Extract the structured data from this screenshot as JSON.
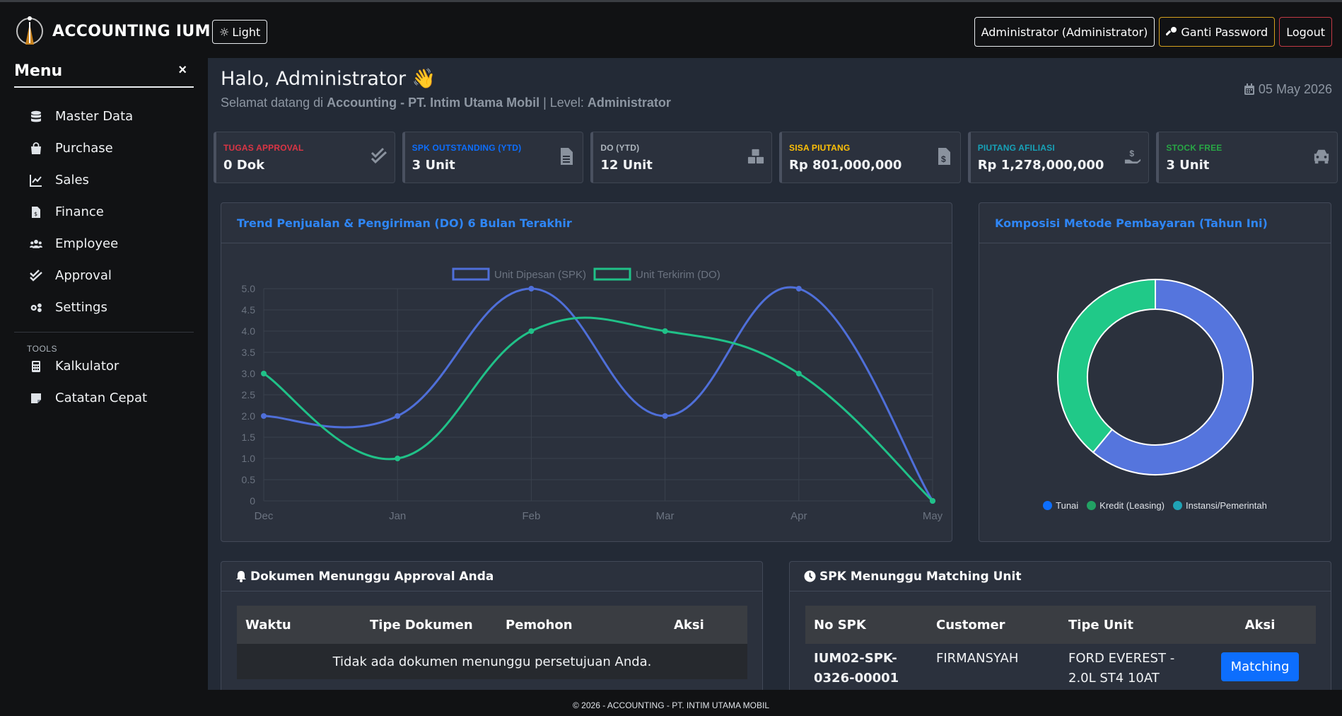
{
  "navbar": {
    "brand": "ACCOUNTING IUM",
    "theme_label": "Light",
    "user_label": "Administrator (Administrator)",
    "password_label": "Ganti Password",
    "logout_label": "Logout"
  },
  "sidebar": {
    "title": "Menu",
    "close": "×",
    "items": [
      {
        "label": "Master Data",
        "icon": "database-icon"
      },
      {
        "label": "Purchase",
        "icon": "shopping-bag-icon"
      },
      {
        "label": "Sales",
        "icon": "line-chart-icon"
      },
      {
        "label": "Finance",
        "icon": "invoice-icon"
      },
      {
        "label": "Employee",
        "icon": "users-icon"
      },
      {
        "label": "Approval",
        "icon": "double-check-icon"
      },
      {
        "label": "Settings",
        "icon": "gears-icon"
      }
    ],
    "tools_title": "TOOLS",
    "tools": [
      {
        "label": "Kalkulator",
        "icon": "calculator-icon"
      },
      {
        "label": "Catatan Cepat",
        "icon": "sticky-note-icon"
      }
    ]
  },
  "header": {
    "greeting": "Halo, Administrator 👋",
    "welcome_prefix": "Selamat datang di ",
    "app_name": "Accounting - PT. Intim Utama Mobil",
    "level_prefix": " | Level: ",
    "level": "Administrator",
    "date": "05 May 2026"
  },
  "cards": [
    {
      "label": "TUGAS APPROVAL",
      "value": "0 Dok",
      "color": "#dc3545",
      "icon": "double-check-icon"
    },
    {
      "label": "SPK OUTSTANDING (YTD)",
      "value": "3 Unit",
      "color": "#0d6efd",
      "icon": "file-icon"
    },
    {
      "label": "DO (YTD)",
      "value": "12 Unit",
      "color": "#adb5bd",
      "icon": "boxes-icon"
    },
    {
      "label": "SISA PIUTANG",
      "value": "Rp 801,000,000",
      "color": "#ffc107",
      "icon": "invoice-dollar-icon"
    },
    {
      "label": "PIUTANG AFILIASI",
      "value": "Rp 1,278,000,000",
      "color": "#17a2b8",
      "icon": "hand-dollar-icon"
    },
    {
      "label": "STOCK FREE",
      "value": "3 Unit",
      "color": "#28a745",
      "icon": "car-icon"
    }
  ],
  "line_panel": {
    "title": "Trend Penjualan & Pengiriman (DO) 6 Bulan Terakhir"
  },
  "donut_panel": {
    "title": "Komposisi Metode Pembayaran (Tahun Ini)"
  },
  "chart_data": [
    {
      "type": "line",
      "x": [
        "Dec",
        "Jan",
        "Feb",
        "Mar",
        "Apr",
        "May"
      ],
      "series": [
        {
          "name": "Unit Dipesan (SPK)",
          "values": [
            2,
            2,
            5,
            2,
            5,
            0
          ],
          "color": "#4f6fd9"
        },
        {
          "name": "Unit Terkirim (DO)",
          "values": [
            3,
            1,
            4,
            4,
            3,
            0
          ],
          "color": "#20c188"
        }
      ],
      "ylim": [
        0,
        5
      ],
      "yticks": [
        "0",
        "0.5",
        "1.0",
        "1.5",
        "2.0",
        "2.5",
        "3.0",
        "3.5",
        "4.0",
        "4.5",
        "5.0"
      ],
      "grid": true,
      "legend": "top"
    },
    {
      "type": "pie",
      "categories": [
        "Tunai",
        "Kredit (Leasing)",
        "Instansi/Pemerintah"
      ],
      "values": [
        61,
        39,
        0
      ],
      "colors": [
        "#5575dd",
        "#20c988",
        "#20a3b5"
      ],
      "legend_colors": [
        "#0d6efd",
        "#22a163",
        "#20a3b5"
      ],
      "legend": "bottom"
    }
  ],
  "approval_panel": {
    "title": "Dokumen Menunggu Approval Anda",
    "columns": [
      "Waktu",
      "Tipe Dokumen",
      "Pemohon",
      "Aksi"
    ],
    "empty": "Tidak ada dokumen menunggu persetujuan Anda."
  },
  "spk_panel": {
    "title": "SPK Menunggu Matching Unit",
    "columns": [
      "No SPK",
      "Customer",
      "Tipe Unit",
      "Aksi"
    ],
    "rows": [
      {
        "no_spk": "IUM02-SPK-0326-00001",
        "customer": "FIRMANSYAH",
        "tipe_unit": "FORD EVEREST - 2.0L ST4 10AT",
        "action": "Matching"
      }
    ]
  },
  "footer": "© 2026 - ACCOUNTING - PT. INTIM UTAMA MOBIL"
}
